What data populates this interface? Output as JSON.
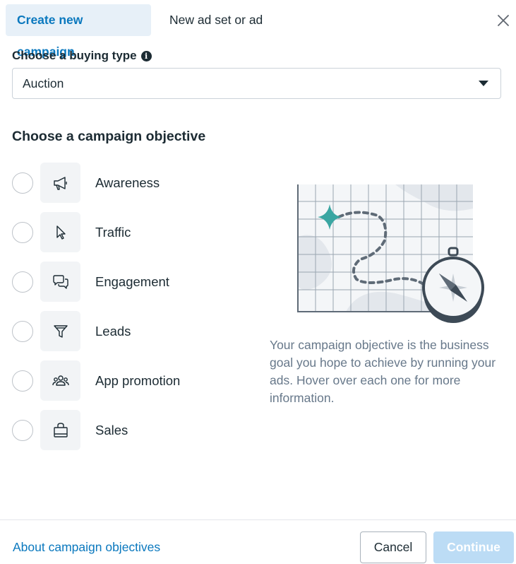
{
  "tabs": [
    {
      "label": "Create new campaign",
      "active": true
    },
    {
      "label": "New ad set or ad",
      "active": false
    }
  ],
  "buying_type": {
    "label": "Choose a buying type",
    "selected": "Auction"
  },
  "objective": {
    "heading": "Choose a campaign objective",
    "options": [
      {
        "label": "Awareness",
        "icon": "megaphone-icon"
      },
      {
        "label": "Traffic",
        "icon": "cursor-icon"
      },
      {
        "label": "Engagement",
        "icon": "chat-bubbles-icon"
      },
      {
        "label": "Leads",
        "icon": "filter-icon"
      },
      {
        "label": "App promotion",
        "icon": "people-icon"
      },
      {
        "label": "Sales",
        "icon": "shopping-bag-icon"
      }
    ],
    "description": "Your campaign objective is the business goal you hope to achieve by running your ads. Hover over each one for more information."
  },
  "footer": {
    "about_link": "About campaign objectives",
    "cancel_label": "Cancel",
    "continue_label": "Continue"
  },
  "colors": {
    "accent": "#0a78be",
    "active_tab_bg": "#e7f0f8",
    "continue_disabled_bg": "#bcdcf5",
    "illustration_teal": "#3aa6a2"
  }
}
